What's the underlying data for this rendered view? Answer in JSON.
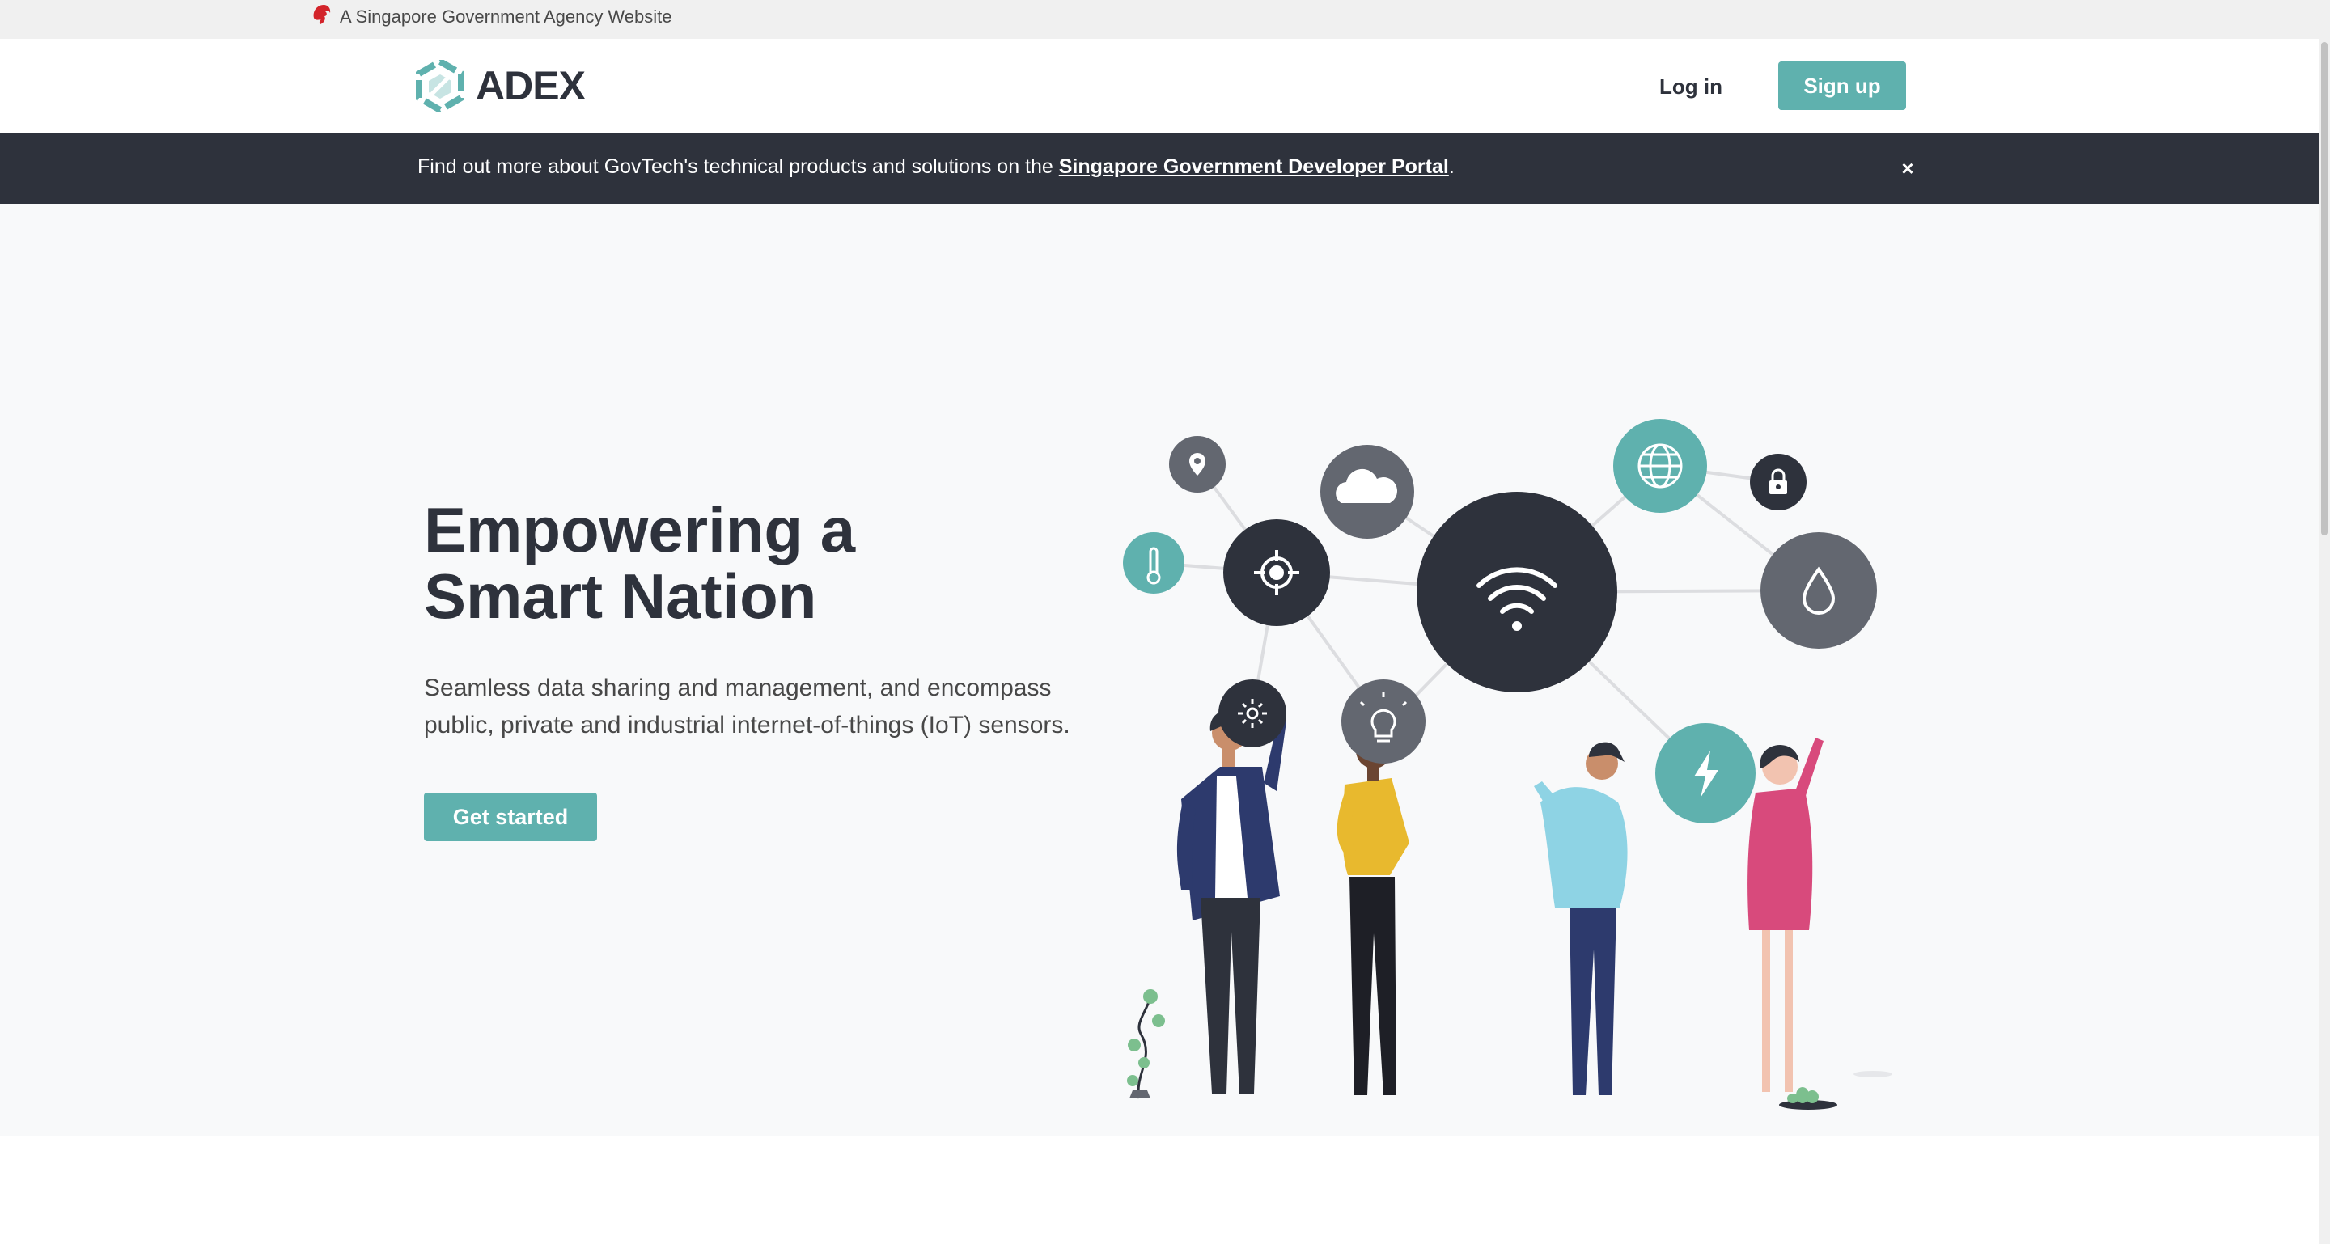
{
  "masthead": {
    "text": "A Singapore Government Agency Website",
    "icon": "lion-head-icon"
  },
  "navbar": {
    "logo_text": "ADEX",
    "login_label": "Log in",
    "signup_label": "Sign up"
  },
  "announcement": {
    "text_before": "Find out more about GovTech's technical products and solutions on the ",
    "link_text": "Singapore Government Developer Portal",
    "text_after": ".",
    "close_label": "×"
  },
  "hero": {
    "title_line1": "Empowering a",
    "title_line2": "Smart Nation",
    "subtitle": "Seamless data sharing and management, and encompass public, private and industrial internet-of-things (IoT) sensors.",
    "cta_label": "Get started"
  },
  "illustration_icons": [
    "location-pin-icon",
    "cloud-icon",
    "globe-icon",
    "lock-icon",
    "thermometer-icon",
    "crosshair-icon",
    "wifi-icon",
    "water-drop-icon",
    "sun-icon",
    "lightbulb-icon",
    "lightning-icon"
  ],
  "colors": {
    "accent": "#5fb1ae",
    "dark": "#2e323c",
    "grey": "#636770",
    "hero_bg": "#f8f9fa",
    "pink": "#d84a7c",
    "yellow": "#e8b92e",
    "light_blue": "#8ed3e4",
    "navy": "#2d3a6d"
  }
}
